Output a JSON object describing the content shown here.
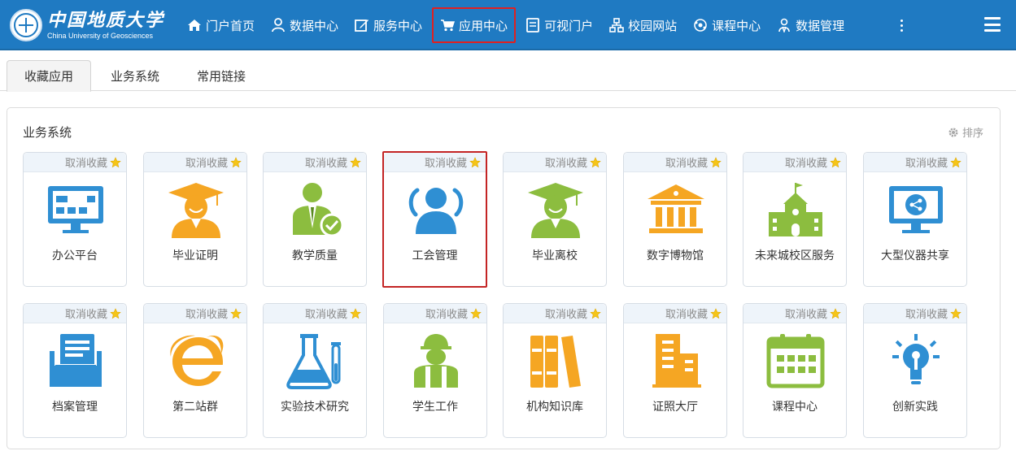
{
  "brand": {
    "name_cn": "中国地质大学",
    "name_en": "China University of Geosciences"
  },
  "colors": {
    "nav_bg": "#1f7ac2",
    "highlight": "#e02020",
    "blue_icon": "#2f8fd3",
    "orange_icon": "#f5a623",
    "green_icon": "#8cbd3f",
    "star": "#f5c518"
  },
  "nav": {
    "items": [
      {
        "label": "门户首页",
        "icon": "home-icon"
      },
      {
        "label": "数据中心",
        "icon": "user-icon"
      },
      {
        "label": "服务中心",
        "icon": "edit-icon"
      },
      {
        "label": "应用中心",
        "icon": "cart-icon",
        "active": true
      },
      {
        "label": "可视门户",
        "icon": "monitor-icon"
      },
      {
        "label": "校园网站",
        "icon": "sitemap-icon"
      },
      {
        "label": "课程中心",
        "icon": "network-icon"
      },
      {
        "label": "数据管理",
        "icon": "users-icon"
      }
    ],
    "more_icon": "more-vertical-icon",
    "menu_icon": "hamburger-icon"
  },
  "tabs": [
    {
      "label": "收藏应用",
      "active": true
    },
    {
      "label": "业务系统",
      "active": false
    },
    {
      "label": "常用链接",
      "active": false
    }
  ],
  "main": {
    "section_title": "业务系统",
    "sort_label": "排序",
    "sort_icon": "gear-icon",
    "unfavorite_label": "取消收藏",
    "apps": [
      {
        "label": "办公平台",
        "icon": "office-monitor-icon"
      },
      {
        "label": "毕业证明",
        "icon": "graduate-orange-icon"
      },
      {
        "label": "教学质量",
        "icon": "teacher-check-icon"
      },
      {
        "label": "工会管理",
        "icon": "union-group-icon",
        "selected": true
      },
      {
        "label": "毕业离校",
        "icon": "graduate-green-icon"
      },
      {
        "label": "数字博物馆",
        "icon": "museum-icon"
      },
      {
        "label": "未来城校区服务",
        "icon": "school-building-icon"
      },
      {
        "label": "大型仪器共享",
        "icon": "share-screen-icon"
      },
      {
        "label": "档案管理",
        "icon": "archive-icon"
      },
      {
        "label": "第二站群",
        "icon": "ie-browser-icon"
      },
      {
        "label": "实验技术研究",
        "icon": "lab-flask-icon"
      },
      {
        "label": "学生工作",
        "icon": "worker-icon"
      },
      {
        "label": "机构知识库",
        "icon": "books-icon"
      },
      {
        "label": "证照大厅",
        "icon": "building-icon"
      },
      {
        "label": "课程中心",
        "icon": "calendar-icon"
      },
      {
        "label": "创新实践",
        "icon": "lightbulb-icon"
      }
    ]
  }
}
